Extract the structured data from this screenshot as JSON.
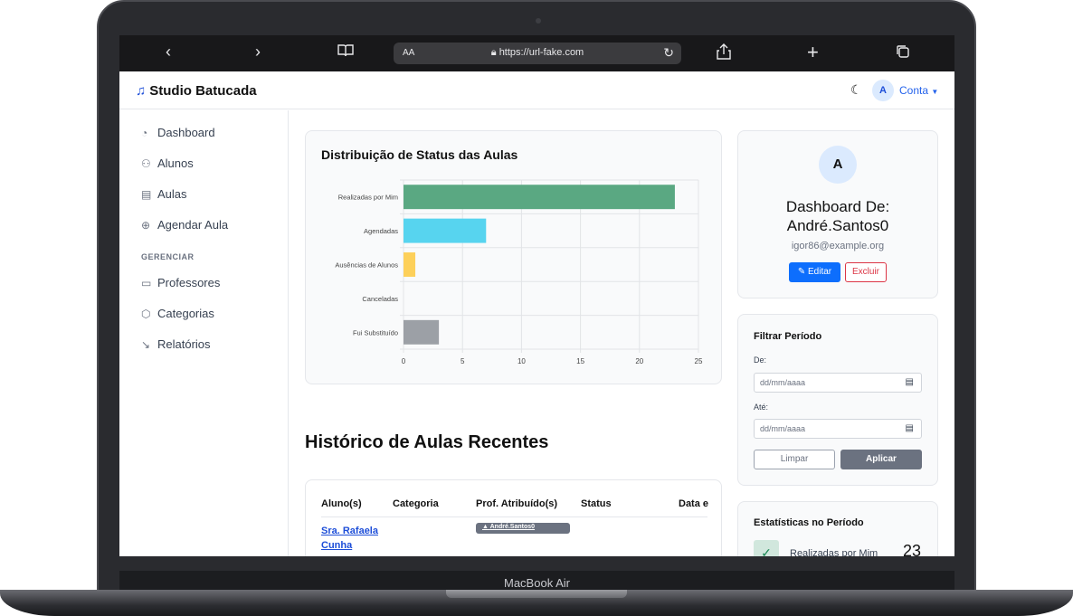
{
  "device": {
    "label": "MacBook Air"
  },
  "browser": {
    "back_icon": "chevron-left",
    "forward_icon": "chevron-right",
    "bookmarks_icon": "book",
    "text_size": "AA",
    "url": "https://url-fake.com",
    "reload_icon": "reload",
    "share_icon": "share",
    "newtab_icon": "plus",
    "tabs_icon": "tabs"
  },
  "header": {
    "app_name": "Studio Batucada",
    "theme_icon": "moon",
    "avatar_initial": "A",
    "account_label": "Conta"
  },
  "sidebar": {
    "items": [
      {
        "label": "Dashboard",
        "icon": "speedometer"
      },
      {
        "label": "Alunos",
        "icon": "people"
      },
      {
        "label": "Aulas",
        "icon": "calendar"
      },
      {
        "label": "Agendar Aula",
        "icon": "plus-circle"
      }
    ],
    "section_heading": "GERENCIAR",
    "manage_items": [
      {
        "label": "Professores",
        "icon": "easel"
      },
      {
        "label": "Categorias",
        "icon": "tag"
      },
      {
        "label": "Relatórios",
        "icon": "graph"
      }
    ]
  },
  "chart_card": {
    "title": "Distribuição de Status das Aulas"
  },
  "chart_data": {
    "type": "bar",
    "orientation": "horizontal",
    "title": "Distribuição de Status das Aulas",
    "categories": [
      "Realizadas por Mim",
      "Agendadas",
      "Ausências de Alunos",
      "Canceladas",
      "Fui Substituído"
    ],
    "values": [
      23,
      7,
      1,
      0,
      3
    ],
    "colors": [
      "#5aa882",
      "#57d4ef",
      "#fdd05a",
      "#cccccc",
      "#9ca0a6"
    ],
    "xlim": [
      0,
      25
    ],
    "xticks": [
      0,
      5,
      10,
      15,
      20,
      25
    ],
    "grid": true
  },
  "profile": {
    "avatar_initial": "A",
    "name_line1": "Dashboard De:",
    "name_line2": "André.Santos0",
    "email": "igor86@example.org",
    "edit_label": "Editar",
    "delete_label": "Excluir"
  },
  "filter": {
    "title": "Filtrar Período",
    "from_label": "De:",
    "from_placeholder": "dd/mm/aaaa",
    "to_label": "Até:",
    "to_placeholder": "dd/mm/aaaa",
    "clear_label": "Limpar",
    "apply_label": "Aplicar"
  },
  "stats": {
    "title": "Estatísticas no Período",
    "row_label": "Realizadas por Mim",
    "row_count": "23"
  },
  "history": {
    "title": "Histórico de Aulas Recentes",
    "columns": [
      "Aluno(s)",
      "Categoria",
      "Prof. Atribuído(s)",
      "Status",
      "Data e"
    ],
    "rows": [
      {
        "student_line1": "Sra. Rafaela",
        "student_line2": "Cunha",
        "category": "",
        "professor": "André.Santos0",
        "status": ""
      }
    ]
  }
}
